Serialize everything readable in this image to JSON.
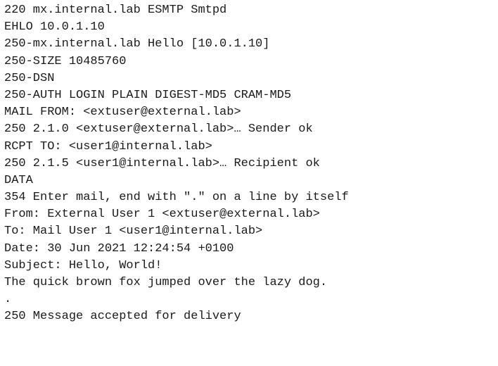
{
  "transcript": {
    "lines": [
      "220 mx.internal.lab ESMTP Smtpd",
      "EHLO 10.0.1.10",
      "250-mx.internal.lab Hello [10.0.1.10]",
      "250-SIZE 10485760",
      "250-DSN",
      "250-AUTH LOGIN PLAIN DIGEST-MD5 CRAM-MD5",
      "MAIL FROM: <extuser@external.lab>",
      "250 2.1.0 <extuser@external.lab>… Sender ok",
      "RCPT TO: <user1@internal.lab>",
      "250 2.1.5 <user1@internal.lab>… Recipient ok",
      "DATA",
      "354 Enter mail, end with \".\" on a line by itself",
      "From: External User 1 <extuser@external.lab>",
      "To: Mail User 1 <user1@internal.lab>",
      "Date: 30 Jun 2021 12:24:54 +0100",
      "Subject: Hello, World!",
      "The quick brown fox jumped over the lazy dog.",
      ".",
      "250 Message accepted for delivery"
    ]
  }
}
